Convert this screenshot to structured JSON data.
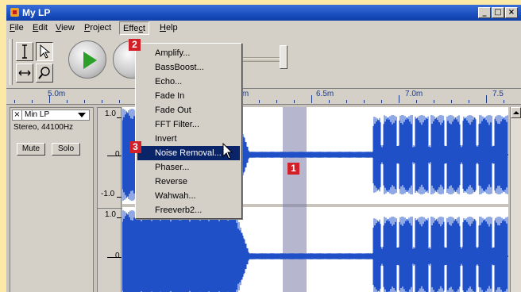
{
  "window": {
    "title": "My LP"
  },
  "menubar": {
    "items": [
      {
        "label": "File",
        "mnemonic": "F",
        "rest": "ile"
      },
      {
        "label": "Edit",
        "mnemonic": "E",
        "rest": "dit"
      },
      {
        "label": "View",
        "mnemonic": "V",
        "rest": "iew"
      },
      {
        "label": "Project",
        "mnemonic": "P",
        "rest": "roject"
      },
      {
        "label": "Effect",
        "mnemonic": "c",
        "pre": "Effe",
        "post": "t"
      },
      {
        "label": "Help",
        "mnemonic": "H",
        "rest": "elp"
      }
    ]
  },
  "toolbar": {
    "tools": [
      "selection-tool",
      "envelope-tool",
      "timeshift-tool",
      "zoom-tool"
    ]
  },
  "ruler": {
    "labels": [
      "5.0m",
      "6.0m",
      "6.5m",
      "7.0m",
      "7.5"
    ]
  },
  "track": {
    "name": "Min LP",
    "format": "Stereo, 44100Hz",
    "mute_label": "Mute",
    "solo_label": "Solo",
    "scale": [
      "1.0",
      "0",
      "-1.0",
      "1.0",
      "0"
    ]
  },
  "effect_menu": {
    "items": [
      "Amplify...",
      "BassBoost...",
      "Echo...",
      "Fade In",
      "Fade Out",
      "FFT Filter...",
      "Invert",
      "Noise Removal...",
      "Phaser...",
      "Reverse",
      "Wahwah...",
      "Freeverb2..."
    ],
    "highlighted_index": 7
  },
  "callouts": [
    "1",
    "2",
    "3"
  ],
  "colors": {
    "waveform": "#2050c8",
    "selection": "#7a7aa8",
    "highlight": "#0a246a",
    "callout": "#d22028"
  }
}
